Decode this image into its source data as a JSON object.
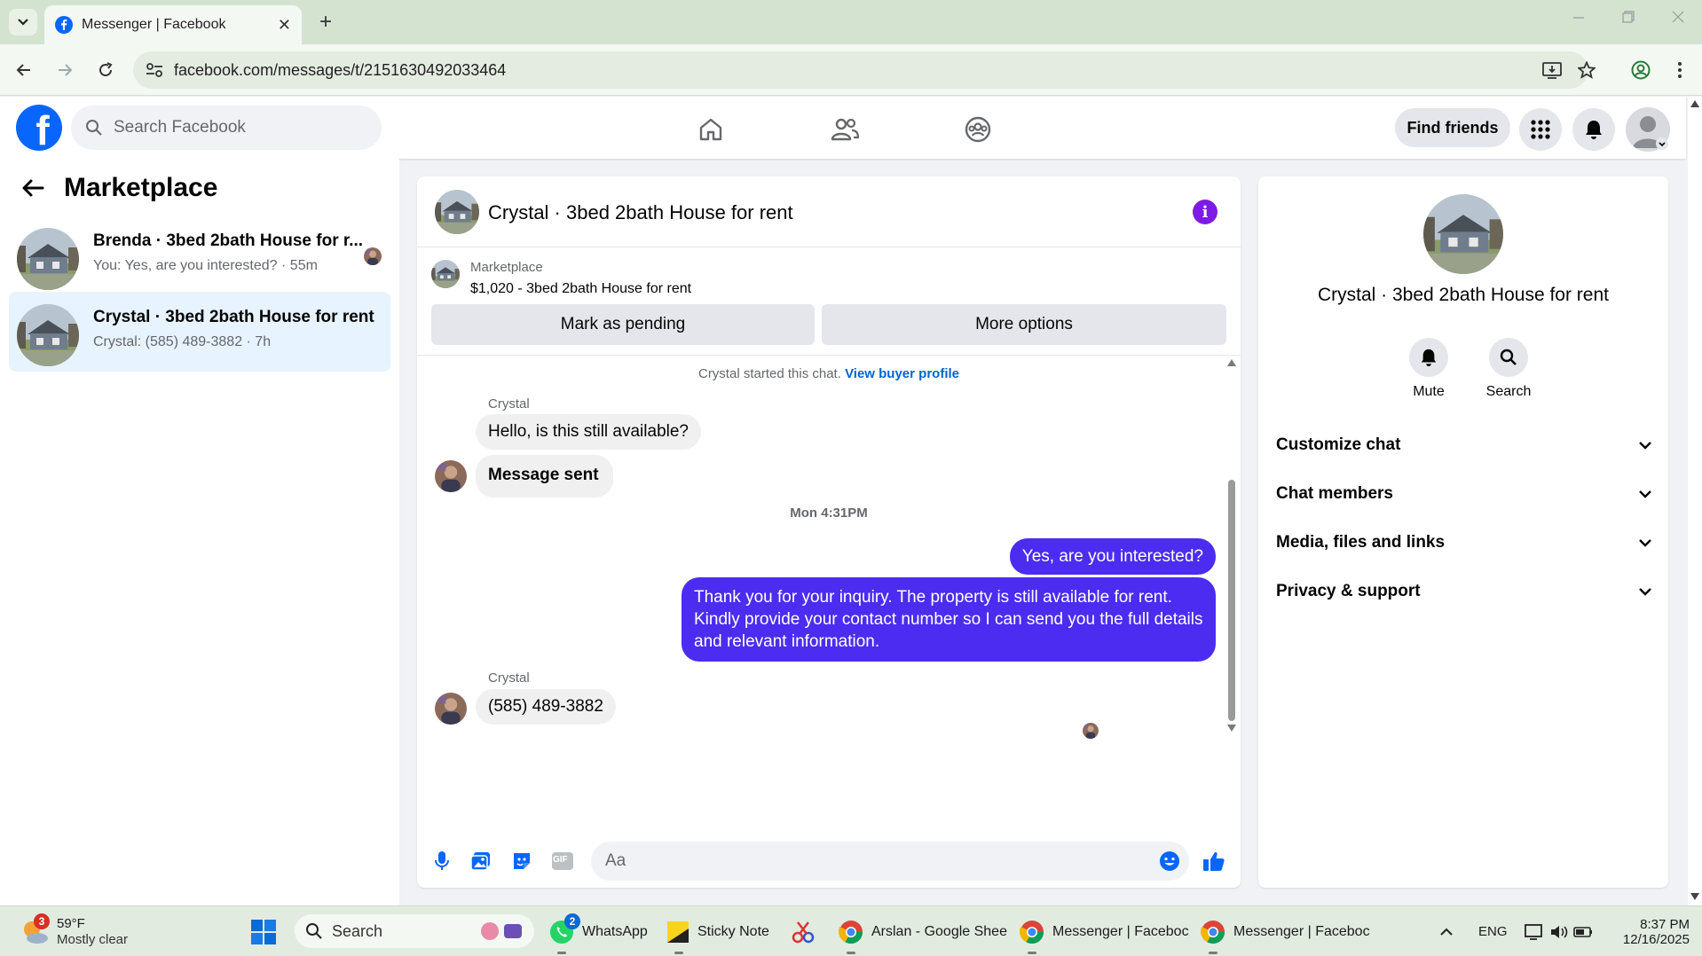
{
  "browser": {
    "tab_title": "Messenger | Facebook",
    "new_tab": "+",
    "close": "✕",
    "url": "facebook.com/messages/t/2151630492033464"
  },
  "fb_header": {
    "search_placeholder": "Search Facebook",
    "find_friends": "Find friends"
  },
  "left_panel": {
    "title": "Marketplace",
    "conversations": [
      {
        "name": "Brenda · 3bed 2bath House for r...",
        "preview": "You: Yes, are you interested? · 55m",
        "active": false
      },
      {
        "name": "Crystal · 3bed 2bath House for rent",
        "preview": "Crystal: (585) 489-3882 · 7h",
        "active": true
      }
    ]
  },
  "chat": {
    "title": "Crystal · 3bed 2bath House for rent",
    "info_icon": "i",
    "listing_source": "Marketplace",
    "listing_desc": "$1,020 - 3bed 2bath House for rent",
    "mark_pending": "Mark as pending",
    "more_options": "More options",
    "started_text": "Crystal started this chat.",
    "view_buyer_profile": "View buyer profile",
    "sender_name": "Crystal",
    "msg1": "Hello, is this still available?",
    "msg2": "Message sent",
    "timestamp": "Mon 4:31PM",
    "out1": "Yes, are you interested?",
    "out2": "Thank you for your inquiry. The property is still available for rent. Kindly provide your contact number so I can send you the full details and relevant information.",
    "sender_name_2": "Crystal",
    "msg3": "(585) 489-3882",
    "composer_placeholder": "Aa",
    "gif_label": "GIF"
  },
  "right_panel": {
    "title": "Crystal · 3bed 2bath House for rent",
    "mute": "Mute",
    "search": "Search",
    "rows": [
      "Customize chat",
      "Chat members",
      "Media, files and links",
      "Privacy & support"
    ]
  },
  "taskbar": {
    "weather_temp": "59°F",
    "weather_desc": "Mostly clear",
    "weather_badge": "3",
    "search": "Search",
    "whatsapp": "WhatsApp",
    "whatsapp_badge": "2",
    "sticky": "Sticky Note",
    "sheets": "Arslan - Google Shee",
    "messenger1": "Messenger | Faceboc",
    "messenger2": "Messenger | Faceboc",
    "lang": "ENG",
    "time": "8:37 PM",
    "date": "12/16/2025"
  },
  "colors": {
    "fb_blue": "#0866ff",
    "outgoing_bubble": "#4c2cf0",
    "incoming_bubble": "#f0f0f0",
    "active_conversation": "#e7f3ff",
    "info_purple": "#7e1ae6",
    "link_blue": "#0064d1"
  }
}
